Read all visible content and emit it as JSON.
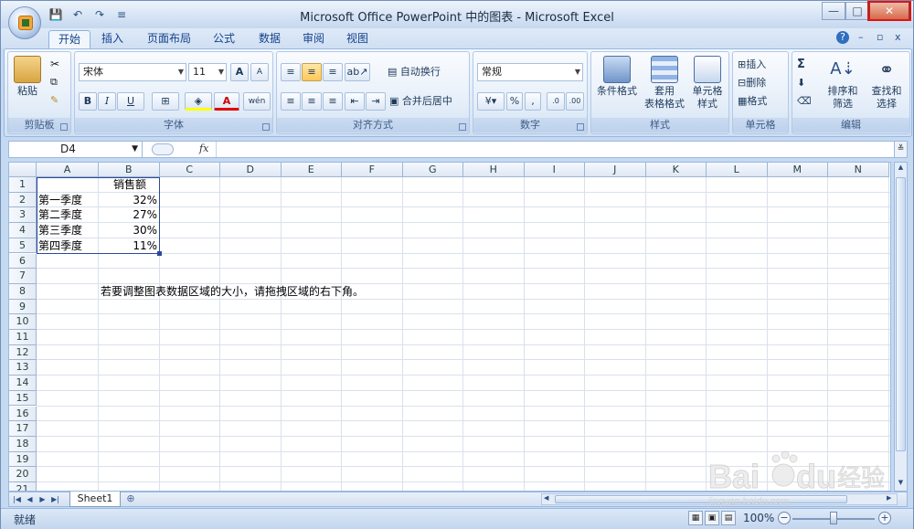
{
  "window": {
    "title": "Microsoft Office PowerPoint 中的图表 - Microsoft Excel",
    "minimize": "—",
    "restore": "□",
    "close": "✕"
  },
  "qat": {
    "save": "💾",
    "undo": "↶",
    "redo": "↷",
    "customize": "≡"
  },
  "tabs": [
    "开始",
    "插入",
    "页面布局",
    "公式",
    "数据",
    "审阅",
    "视图"
  ],
  "mdi": {
    "help": "?",
    "minimize": "–",
    "restore": "▫",
    "close": "x"
  },
  "ribbon": {
    "clipboard": {
      "label": "剪贴板",
      "paste": "粘贴"
    },
    "font": {
      "label": "字体",
      "name": "宋体",
      "size": "11",
      "bold": "B",
      "italic": "I",
      "underline": "U",
      "grow": "A",
      "shrink": "A",
      "color_letter": "A",
      "phonetic": "wén"
    },
    "alignment": {
      "label": "对齐方式",
      "wrap": "自动换行",
      "merge": "合并后居中"
    },
    "number": {
      "label": "数字",
      "format": "常规",
      "percent": "%",
      "comma": ",",
      "inc": ".0",
      "dec": ".00"
    },
    "styles": {
      "label": "样式",
      "conditional": "条件格式",
      "table1": "套用",
      "table2": "表格格式",
      "cell1": "单元格",
      "cell2": "样式"
    },
    "cells": {
      "label": "单元格",
      "insert": "插入",
      "delete": "删除",
      "format": "格式"
    },
    "editing": {
      "label": "编辑",
      "sum": "Σ",
      "sort1": "排序和",
      "sort2": "筛选",
      "find1": "查找和",
      "find2": "选择"
    }
  },
  "formula_bar": {
    "name_box": "D4",
    "fx": "fx",
    "formula": ""
  },
  "grid": {
    "columns": [
      "A",
      "B",
      "C",
      "D",
      "E",
      "F",
      "G",
      "H",
      "I",
      "J",
      "K",
      "L",
      "M",
      "N"
    ],
    "rows": [
      "1",
      "2",
      "3",
      "4",
      "5",
      "6",
      "7",
      "8",
      "9",
      "10",
      "11",
      "12",
      "13",
      "14",
      "15",
      "16",
      "17",
      "18",
      "19",
      "20",
      "21"
    ],
    "cells": {
      "B1": "销售额",
      "A2": "第一季度",
      "B2": "32%",
      "A3": "第二季度",
      "B3": "27%",
      "A4": "第三季度",
      "B4": "30%",
      "A5": "第四季度",
      "B5": "11%",
      "B8": "若要调整图表数据区域的大小，请拖拽区域的右下角。"
    }
  },
  "sheet_tabs": {
    "active": "Sheet1",
    "insert": "⊕"
  },
  "statusbar": {
    "ready": "就绪",
    "zoom": "100%",
    "minus": "−",
    "plus": "+"
  },
  "watermark": {
    "text": "jingyan.baidu.com",
    "logo_text": "Bai du 经验"
  },
  "colors": {
    "highlight": "#e21212",
    "selection": "#2b4a9b"
  }
}
